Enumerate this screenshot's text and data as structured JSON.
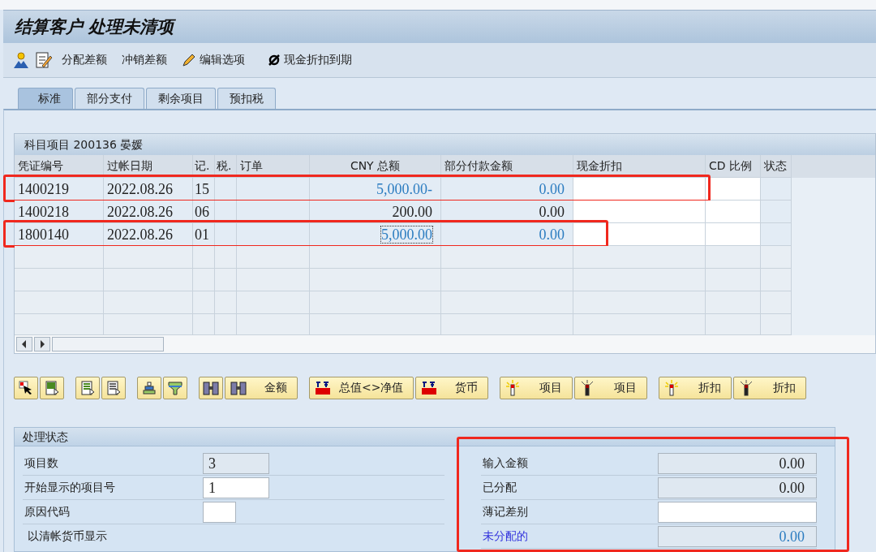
{
  "window": {
    "title": "结算客户 处理未清项"
  },
  "toolbar": [
    {
      "kind": "person"
    },
    {
      "kind": "edit"
    },
    {
      "kind": "text",
      "label": "分配差额"
    },
    {
      "kind": "text",
      "label": "冲销差额"
    },
    {
      "kind": "pencil",
      "label": "编辑选项"
    },
    {
      "kind": "strike",
      "label": "现金折扣到期"
    }
  ],
  "tabs": [
    {
      "label": "标准",
      "selected": true
    },
    {
      "label": "部分支付",
      "selected": false
    },
    {
      "label": "剩余项目",
      "selected": false
    },
    {
      "label": "预扣税",
      "selected": false
    }
  ],
  "table": {
    "title": "科目项目 200136 晏媛",
    "columns": [
      "凭证编号",
      "过帐日期",
      "记.",
      "税.",
      "订单",
      "CNY 总额",
      "部分付款金额",
      "现金折扣",
      "CD 比例",
      "状态"
    ],
    "rows": [
      {
        "doc": "1400219",
        "date": "2022.08.26",
        "key": "15",
        "amount": "5,000.00-",
        "partial": "0.00",
        "active": true,
        "focused": false,
        "marked": true
      },
      {
        "doc": "1400218",
        "date": "2022.08.26",
        "key": "06",
        "amount": "200.00",
        "partial": "0.00",
        "active": false,
        "focused": false,
        "marked": false
      },
      {
        "doc": "1800140",
        "date": "2022.08.26",
        "key": "01",
        "amount": "5,000.00",
        "partial": "0.00",
        "active": true,
        "focused": true,
        "marked": true
      }
    ]
  },
  "buttons": [
    [
      {
        "kind": "select"
      },
      {
        "kind": "layout"
      }
    ],
    [
      {
        "kind": "layout-green"
      },
      {
        "kind": "layout-grey"
      }
    ],
    [
      {
        "kind": "sort-up"
      },
      {
        "kind": "filter"
      }
    ],
    [
      {
        "kind": "find"
      },
      {
        "kind": "find",
        "label": "金额"
      }
    ],
    [
      {
        "kind": "money",
        "label": "总值<>净值"
      },
      {
        "kind": "money",
        "label": "货币"
      }
    ],
    [
      {
        "kind": "lamp-on",
        "label": "项目"
      },
      {
        "kind": "lamp-off",
        "label": "项目"
      }
    ],
    [
      {
        "kind": "lamp-on",
        "label": "折扣"
      },
      {
        "kind": "lamp-off",
        "label": "折扣"
      }
    ]
  ],
  "status_panel": {
    "title": "处理状态",
    "left_fields": [
      {
        "label": "项目数",
        "value": "3",
        "readonly": true,
        "kind": "field"
      },
      {
        "label": "开始显示的项目号",
        "value": "1",
        "readonly": false,
        "kind": "field"
      },
      {
        "label": "原因代码",
        "readonly": false,
        "kind": "short-field"
      },
      {
        "label": "以清帐货币显示",
        "kind": "label"
      }
    ],
    "right_fields": [
      {
        "label": "输入金额",
        "value": "0.00",
        "readonly": true,
        "emphasis": false
      },
      {
        "label": "已分配",
        "value": "0.00",
        "readonly": true,
        "emphasis": false
      },
      {
        "label": "薄记差别",
        "readonly": false,
        "emphasis": false
      },
      {
        "label": "未分配的",
        "value": "0.00",
        "readonly": true,
        "emphasis": true
      }
    ],
    "right_marked": true
  }
}
